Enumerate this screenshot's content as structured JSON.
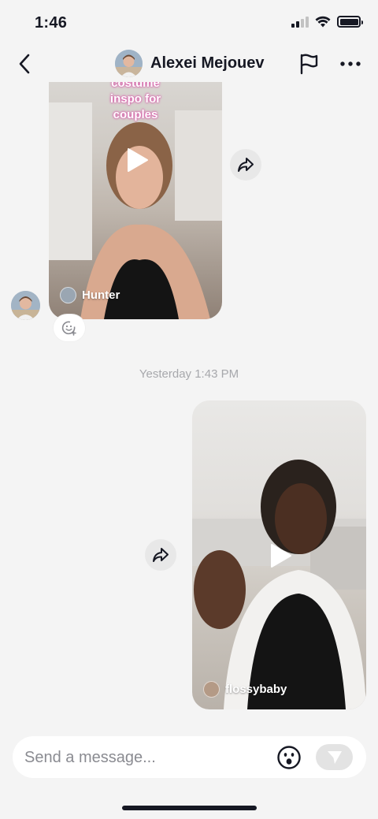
{
  "status_bar": {
    "time": "1:46"
  },
  "header": {
    "contact_name": "Alexei Mejouev"
  },
  "messages": {
    "first_video": {
      "caption_lines": [
        "costume",
        "inspo for",
        "couples"
      ],
      "author": "Hunter"
    },
    "timestamp": "Yesterday 1:43 PM",
    "second_video": {
      "author": "flossybaby"
    }
  },
  "composer": {
    "placeholder": "Send a message..."
  },
  "icons": {
    "back": "chevron-left-icon",
    "flag": "flag-icon",
    "more": "more-horizontal-icon",
    "share": "share-arrow-icon",
    "play": "play-icon",
    "emoji": "emoji-icon",
    "send": "send-icon",
    "react": "add-reaction-icon"
  },
  "colors": {
    "background": "#f4f4f4",
    "text": "#161823",
    "muted": "#a7a8ac",
    "caption_glow": "#d94fa6"
  }
}
